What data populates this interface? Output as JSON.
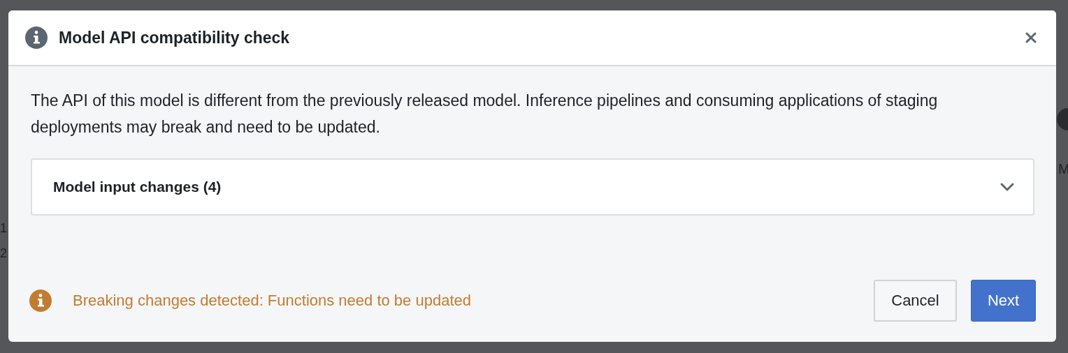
{
  "background": {
    "left_fragments": [
      "1",
      "2"
    ],
    "right_fragments": [
      "M"
    ]
  },
  "dialog": {
    "title": "Model API compatibility check",
    "message": "The API of this model is different from the previously released model. Inference pipelines and consuming applications of staging deployments may break and need to be updated.",
    "section": {
      "label": "Model input changes (4)",
      "expanded": false
    },
    "warning": "Breaking changes detected: Functions need to be updated",
    "buttons": [
      {
        "label": "Cancel",
        "kind": "secondary"
      },
      {
        "label": "Next",
        "kind": "primary"
      }
    ]
  }
}
